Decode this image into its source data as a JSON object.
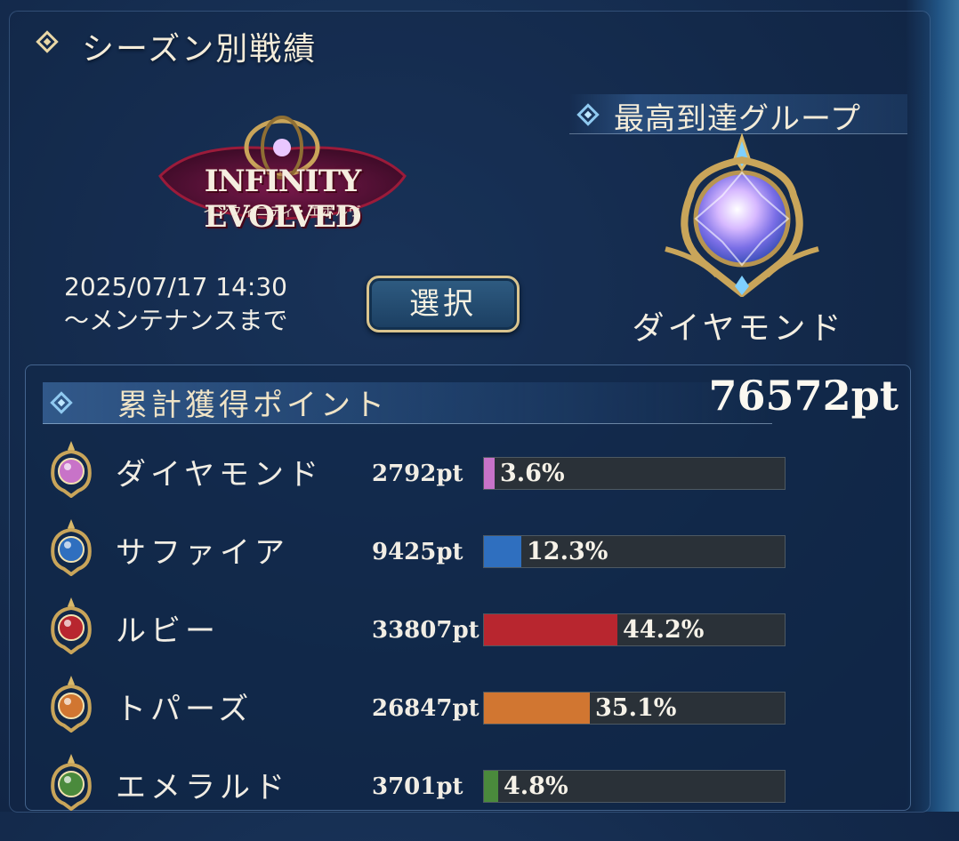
{
  "season": {
    "title": "シーズン別戦績",
    "logo_text": "INFINITY EVOLVED",
    "logo_subtitle": "インフィニティ・エボルヴ",
    "date_line1": "2025/07/17 14:30",
    "date_line2": "～メンテナンスまで",
    "select_label": "選択"
  },
  "top_group": {
    "title": "最高到達グループ",
    "name": "ダイヤモンド"
  },
  "points": {
    "label": "累計獲得ポイント",
    "total": "76572pt",
    "ranks": [
      {
        "name": "ダイヤモンド",
        "points": "2792pt",
        "percent_label": "3.6%",
        "percent": 3.6,
        "color": "#c873c8",
        "gem": "diamond-gem-icon"
      },
      {
        "name": "サファイア",
        "points": "9425pt",
        "percent_label": "12.3%",
        "percent": 12.3,
        "color": "#2f6fbf",
        "gem": "sapphire-gem-icon"
      },
      {
        "name": "ルビー",
        "points": "33807pt",
        "percent_label": "44.2%",
        "percent": 44.2,
        "color": "#b8262f",
        "gem": "ruby-gem-icon"
      },
      {
        "name": "トパーズ",
        "points": "26847pt",
        "percent_label": "35.1%",
        "percent": 35.1,
        "color": "#d17631",
        "gem": "topaz-gem-icon"
      },
      {
        "name": "エメラルド",
        "points": "3701pt",
        "percent_label": "4.8%",
        "percent": 4.8,
        "color": "#4a8a3c",
        "gem": "emerald-gem-icon"
      }
    ]
  }
}
